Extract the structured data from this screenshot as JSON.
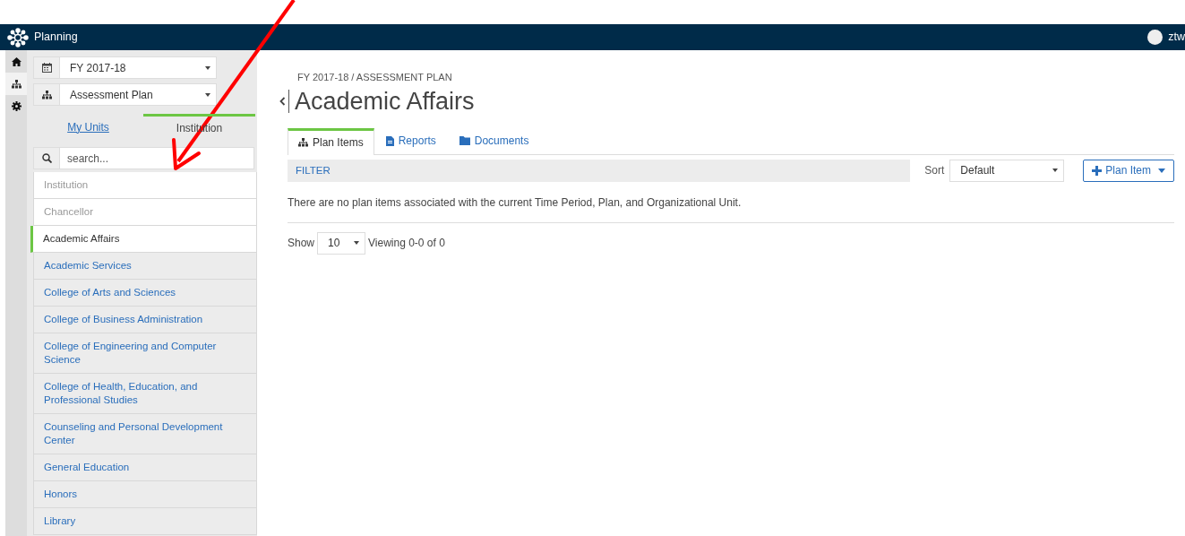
{
  "navbar": {
    "title": "Planning",
    "user": "ztw"
  },
  "rail": [
    {
      "selected": false
    },
    {
      "selected": true
    },
    {
      "selected": false
    }
  ],
  "selectors": [
    {
      "value": "FY 2017-18"
    },
    {
      "value": "Assessment Plan"
    }
  ],
  "unit_tabs": [
    {
      "label": "My Units",
      "selected": false
    },
    {
      "label": "Institution",
      "selected": true
    }
  ],
  "search": {
    "placeholder": "search..."
  },
  "units": [
    {
      "label": "Institution",
      "kind": "ancestor",
      "selected": false
    },
    {
      "label": "Chancellor",
      "kind": "ancestor",
      "selected": false
    },
    {
      "label": "Academic Affairs",
      "kind": "current",
      "selected": true
    },
    {
      "label": "Academic Services",
      "kind": "child",
      "selected": false
    },
    {
      "label": "College of Arts and Sciences",
      "kind": "child",
      "selected": false
    },
    {
      "label": "College of Business Administration",
      "kind": "child",
      "selected": false
    },
    {
      "label": "College of Engineering and Computer Science",
      "kind": "child",
      "selected": false
    },
    {
      "label": "College of Health, Education, and Professional Studies",
      "kind": "child",
      "selected": false
    },
    {
      "label": "Counseling and Personal Development Center",
      "kind": "child",
      "selected": false
    },
    {
      "label": "General Education",
      "kind": "child",
      "selected": false
    },
    {
      "label": "Honors",
      "kind": "child",
      "selected": false
    },
    {
      "label": "Library",
      "kind": "child",
      "selected": false
    }
  ],
  "breadcrumb": "FY 2017-18 / ASSESSMENT PLAN",
  "title": "Academic Affairs",
  "tabs": [
    {
      "label": "Plan Items",
      "selected": true
    },
    {
      "label": "Reports",
      "selected": false
    },
    {
      "label": "Documents",
      "selected": false
    }
  ],
  "filter": {
    "label": "FILTER",
    "sort_label": "Sort",
    "sort_value": "Default",
    "add_button": "Plan Item"
  },
  "empty_message": "There are no plan items associated with the current Time Period, Plan, and Organizational Unit.",
  "pager": {
    "show_label": "Show",
    "page_size": "10",
    "viewing": "Viewing 0-0 of 0"
  },
  "annotations": [
    {
      "kind": "arrow"
    }
  ]
}
